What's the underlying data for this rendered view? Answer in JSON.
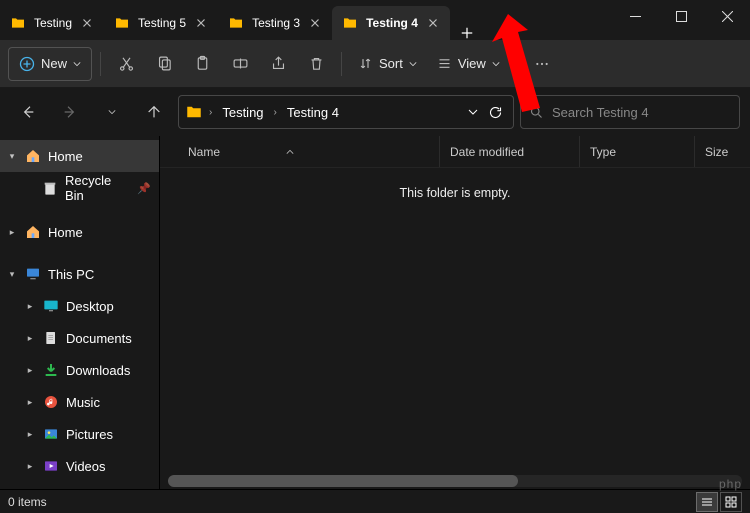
{
  "tabs": {
    "items": [
      {
        "label": "Testing",
        "active": false
      },
      {
        "label": "Testing 5",
        "active": false
      },
      {
        "label": "Testing 3",
        "active": false
      },
      {
        "label": "Testing 4",
        "active": true
      }
    ]
  },
  "toolbar": {
    "new_label": "New",
    "sort_label": "Sort",
    "view_label": "View"
  },
  "breadcrumb": {
    "items": [
      "Testing",
      "Testing 4"
    ]
  },
  "search": {
    "placeholder": "Search Testing 4"
  },
  "sidebar": {
    "home": "Home",
    "recycle_bin": "Recycle Bin",
    "home2": "Home",
    "this_pc": "This PC",
    "desktop": "Desktop",
    "documents": "Documents",
    "downloads": "Downloads",
    "music": "Music",
    "pictures": "Pictures",
    "videos": "Videos"
  },
  "columns": {
    "name": "Name",
    "date_modified": "Date modified",
    "type": "Type",
    "size": "Size"
  },
  "content": {
    "empty_message": "This folder is empty."
  },
  "status": {
    "item_count": "0 items"
  },
  "watermark": "php"
}
